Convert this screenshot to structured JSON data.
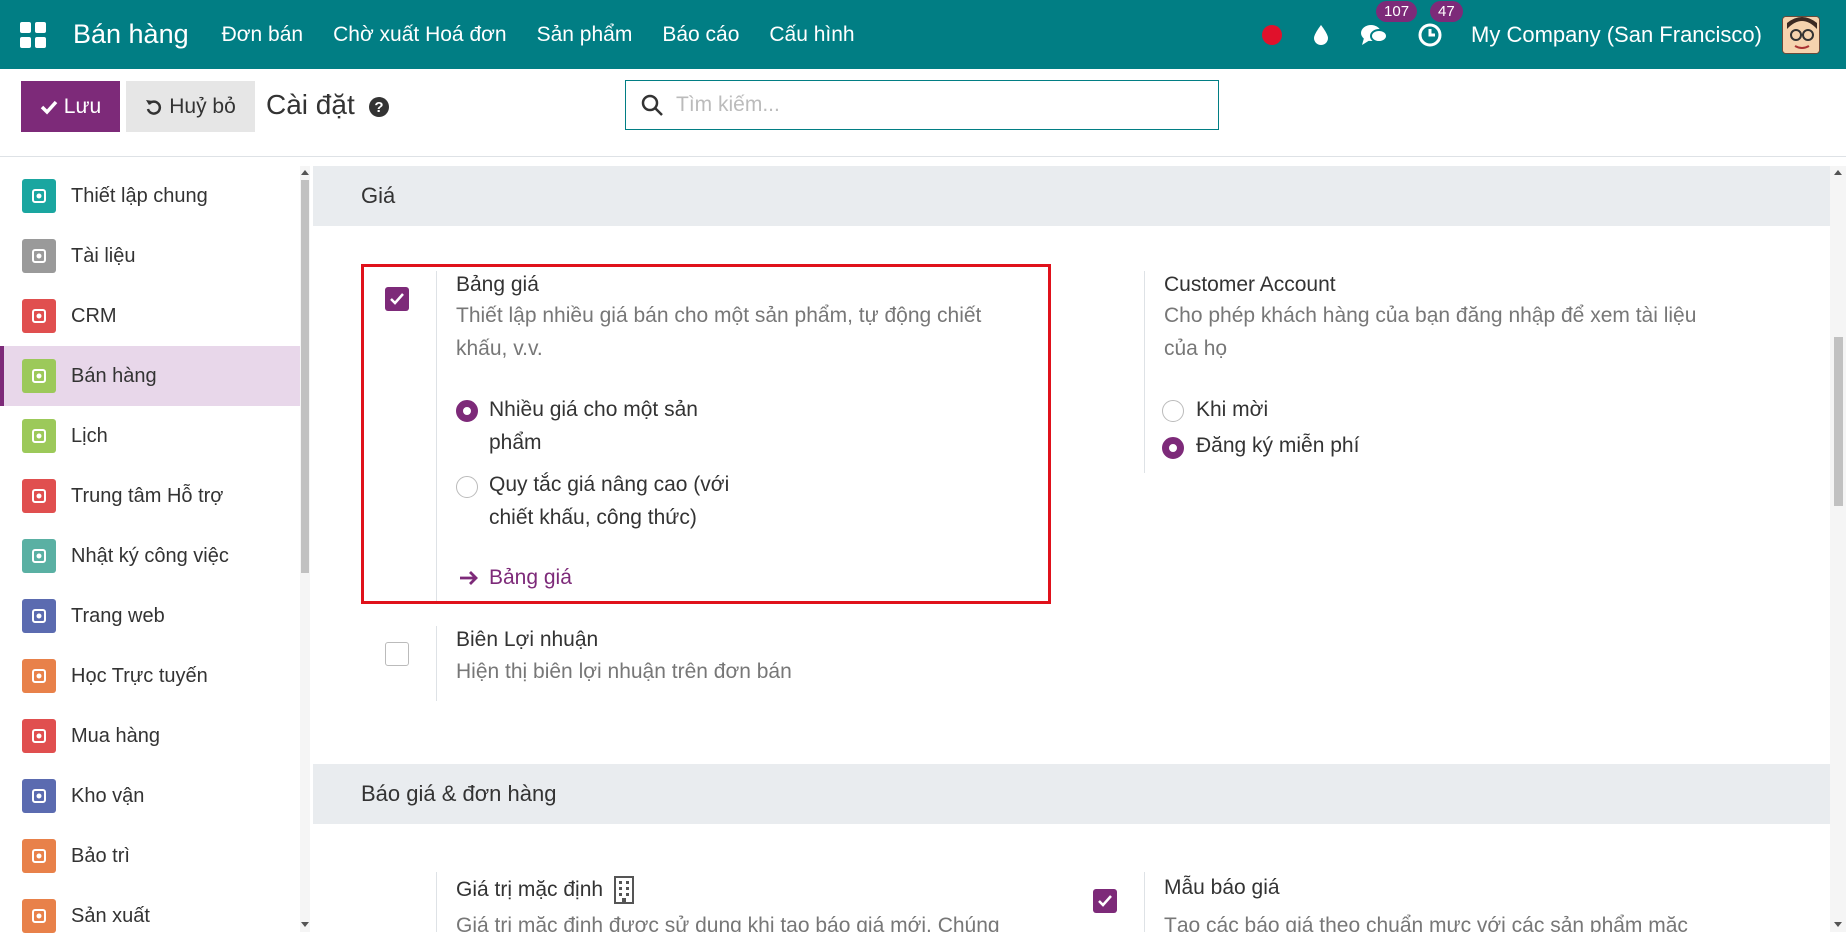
{
  "colors": {
    "brand": "#017e84",
    "primary": "#7d2a79",
    "highlight": "#e0111b"
  },
  "navbar": {
    "app_name": "Bán hàng",
    "menu": [
      "Đơn bán",
      "Chờ xuất Hoá đơn",
      "Sản phẩm",
      "Báo cáo",
      "Cấu hình"
    ],
    "messages_badge": "107",
    "activities_badge": "47",
    "company": "My Company (San Francisco)"
  },
  "control": {
    "save_label": "Lưu",
    "discard_label": "Huỷ bỏ",
    "title": "Cài đặt",
    "search_placeholder": "Tìm kiếm..."
  },
  "sidebar": {
    "items": [
      {
        "label": "Thiết lập chung",
        "color": "#1aa6a0",
        "icon": "gear-icon"
      },
      {
        "label": "Tài liệu",
        "color": "#9a9a9a",
        "icon": "folder-icon"
      },
      {
        "label": "CRM",
        "color": "#e04f4f",
        "icon": "handshake-icon"
      },
      {
        "label": "Bán hàng",
        "color": "#9cc95a",
        "icon": "sales-chart-icon"
      },
      {
        "label": "Lịch",
        "color": "#9cc95a",
        "icon": "calendar-icon"
      },
      {
        "label": "Trung tâm Hỗ trợ",
        "color": "#e04f4f",
        "icon": "helpdesk-icon"
      },
      {
        "label": "Nhật ký công việc",
        "color": "#5ab0a3",
        "icon": "timesheet-icon"
      },
      {
        "label": "Trang web",
        "color": "#5b6bb0",
        "icon": "globe-icon"
      },
      {
        "label": "Học Trực tuyến",
        "color": "#e8814a",
        "icon": "elearning-icon"
      },
      {
        "label": "Mua hàng",
        "color": "#e04f4f",
        "icon": "purchase-icon"
      },
      {
        "label": "Kho vận",
        "color": "#5b6bb0",
        "icon": "inventory-box-icon"
      },
      {
        "label": "Bảo trì",
        "color": "#e8814a",
        "icon": "maintenance-icon"
      },
      {
        "label": "Sản xuất",
        "color": "#e8814a",
        "icon": "manufacturing-icon"
      }
    ],
    "active_index": 3
  },
  "sections": {
    "pricing": {
      "title": "Giá",
      "pricelist": {
        "title": "Bảng giá",
        "desc_line1": "Thiết lập nhiều giá bán cho một sản phẩm, tự động chiết",
        "desc_line2": "khấu, v.v.",
        "checked": true,
        "options": [
          {
            "line1": "Nhiều giá cho một sản",
            "line2": "phẩm",
            "selected": true
          },
          {
            "line1": "Quy tắc giá nâng cao (với",
            "line2": "chiết khấu, công thức)",
            "selected": false
          }
        ],
        "link": "Bảng giá"
      },
      "customer_account": {
        "title": "Customer Account",
        "desc_line1": "Cho phép khách hàng của bạn đăng nhập để xem tài liệu",
        "desc_line2": "của họ",
        "options": [
          {
            "label": "Khi mời",
            "selected": false
          },
          {
            "label": "Đăng ký miễn phí",
            "selected": true
          }
        ]
      },
      "margins": {
        "title": "Biên Lợi nhuận",
        "desc": "Hiện thị biên lợi nhuận trên đơn bán",
        "checked": false
      }
    },
    "quotations": {
      "title": "Báo giá & đơn hàng",
      "default_values": {
        "title": "Giá trị mặc định",
        "desc": "Giá trị mặc định được sử dụng khi tạo báo giá mới. Chúng"
      },
      "templates": {
        "title": "Mẫu báo giá",
        "desc": "Tạo các báo giá theo chuẩn mực với các sản phẩm mặc",
        "checked": true
      }
    }
  }
}
